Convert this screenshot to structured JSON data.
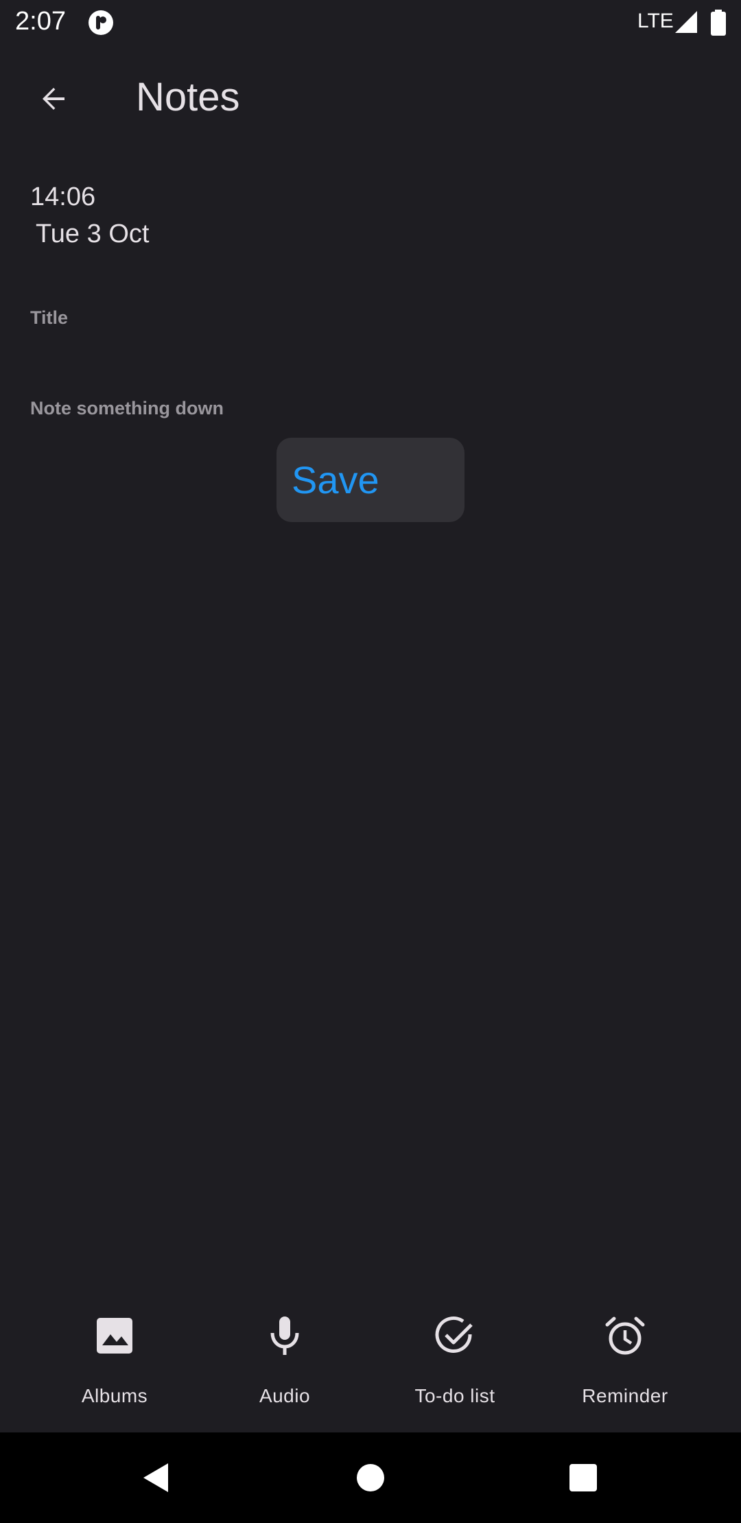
{
  "status_bar": {
    "time": "2:07",
    "network": "LTE",
    "app_icon": "pocketcasts-like-icon",
    "signal_icon": "signal-icon",
    "battery_icon": "battery-icon"
  },
  "app_bar": {
    "title": "Notes",
    "back_icon": "arrow-back-icon"
  },
  "note": {
    "time": "14:06",
    "date": "Tue 3 Oct",
    "title_placeholder": "Title",
    "body_placeholder": "Note something down",
    "title_value": "",
    "body_value": ""
  },
  "save": {
    "label": "Save",
    "color": "#2196f3"
  },
  "actions": [
    {
      "label": "Albums",
      "icon": "image-icon"
    },
    {
      "label": "Audio",
      "icon": "microphone-icon"
    },
    {
      "label": "To-do list",
      "icon": "check-circle-icon"
    },
    {
      "label": "Reminder",
      "icon": "alarm-clock-icon"
    }
  ],
  "colors": {
    "background": "#1e1d22",
    "text": "#e6e1e6",
    "accent": "#2196f3",
    "button_bg": "#323136",
    "nav_bar": "#000000"
  }
}
